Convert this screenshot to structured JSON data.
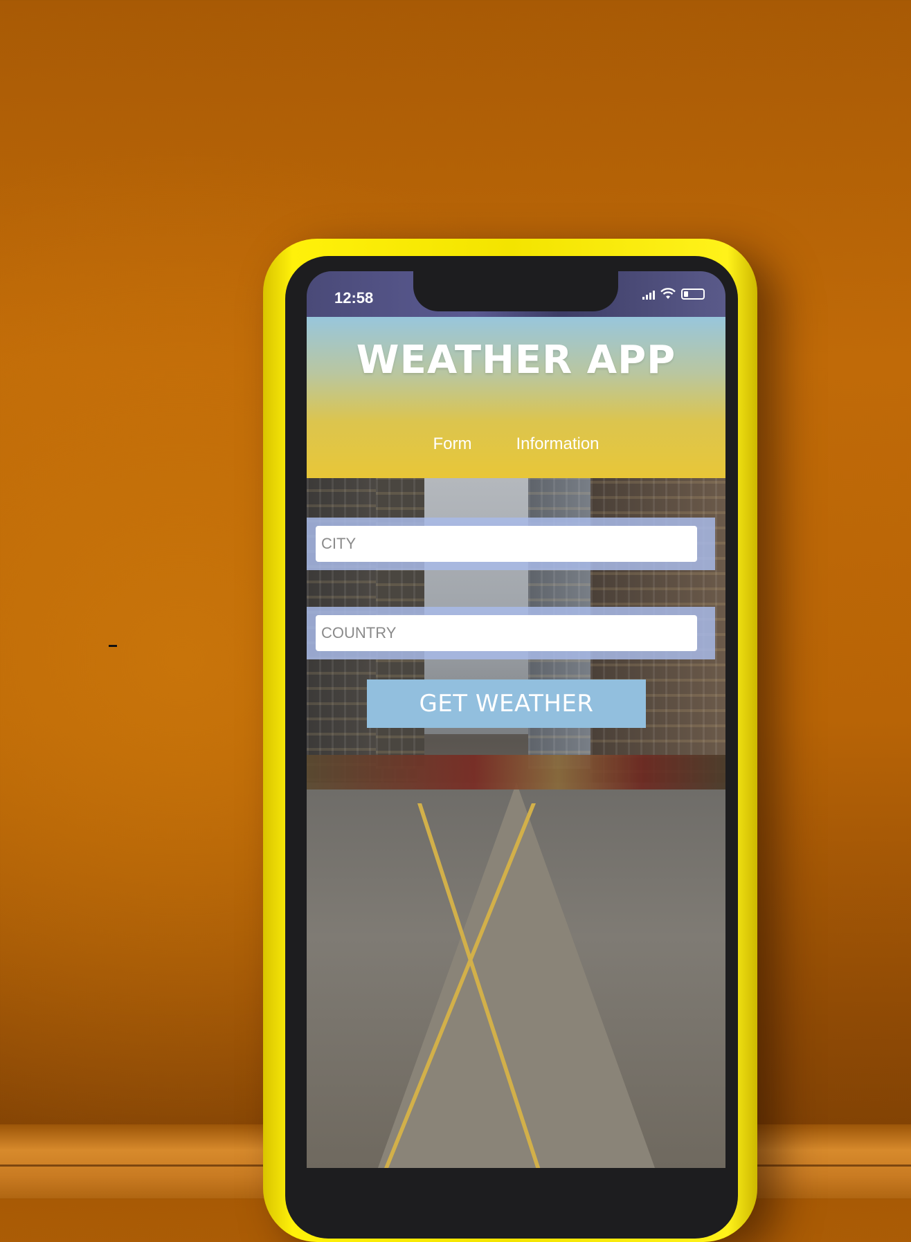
{
  "status_bar": {
    "time": "12:58",
    "icons": [
      "signal-icon",
      "wifi-icon",
      "battery-icon"
    ]
  },
  "app": {
    "title": "WEATHER APP",
    "nav": [
      {
        "label": "Form"
      },
      {
        "label": "Information"
      }
    ],
    "form": {
      "city_placeholder": "CITY",
      "country_placeholder": "COUNTRY",
      "submit_label": "GET WEATHER"
    }
  },
  "colors": {
    "header_top": "#98c6dc",
    "header_bottom": "#e8c638",
    "button": "#92bfde",
    "field_band": "#a8bae8",
    "phone_case": "#f3e400",
    "wall": "#b86406"
  }
}
